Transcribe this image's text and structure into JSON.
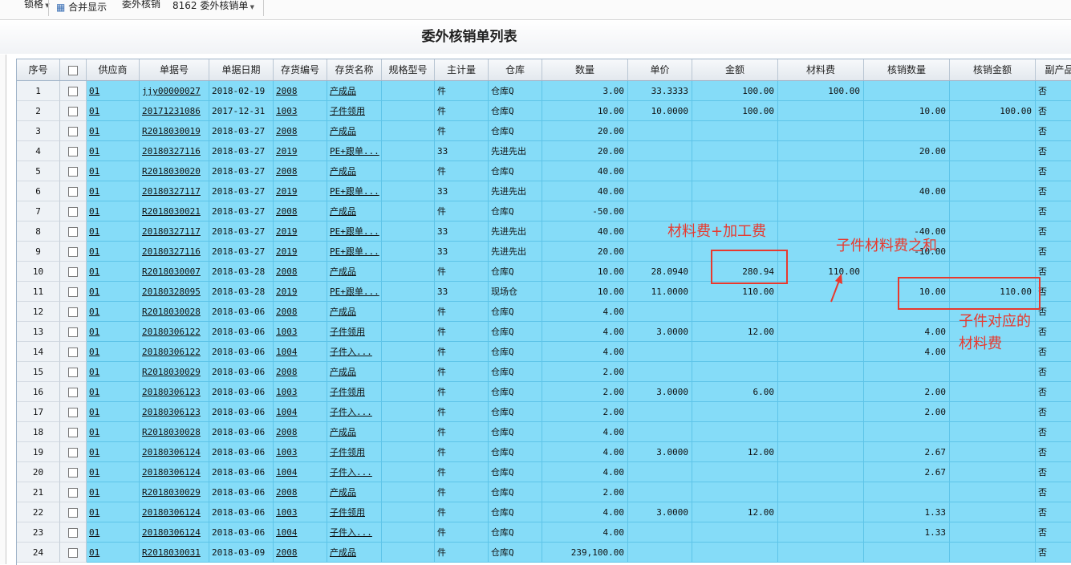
{
  "toolbar": {
    "items": [
      "锁格",
      "合并显示",
      "委外核销",
      "8162 委外核销单"
    ],
    "pos": [
      30,
      70,
      152,
      215
    ]
  },
  "page_title": "委外核销单列表",
  "columns": [
    "序号",
    "",
    "供应商",
    "单据号",
    "单据日期",
    "存货编号",
    "存货名称",
    "规格型号",
    "主计量",
    "仓库",
    "数量",
    "单价",
    "金额",
    "材料费",
    "核销数量",
    "核销金额",
    "副产品"
  ],
  "rows": [
    [
      "1",
      "01",
      "jjy00000027",
      "2018-02-19",
      "2008",
      "产成品",
      "",
      "件",
      "仓库Q",
      "3.00",
      "33.3333",
      "100.00",
      "100.00",
      "",
      "",
      "否"
    ],
    [
      "2",
      "01",
      "20171231086",
      "2017-12-31",
      "1003",
      "子件领用",
      "",
      "件",
      "仓库Q",
      "10.00",
      "10.0000",
      "100.00",
      "",
      "10.00",
      "100.00",
      "否"
    ],
    [
      "3",
      "01",
      "R2018030019",
      "2018-03-27",
      "2008",
      "产成品",
      "",
      "件",
      "仓库Q",
      "20.00",
      "",
      "",
      "",
      "",
      "",
      "否"
    ],
    [
      "4",
      "01",
      "20180327116",
      "2018-03-27",
      "2019",
      "PE+跟单...",
      "",
      "33",
      "先进先出",
      "20.00",
      "",
      "",
      "",
      "20.00",
      "",
      "否"
    ],
    [
      "5",
      "01",
      "R2018030020",
      "2018-03-27",
      "2008",
      "产成品",
      "",
      "件",
      "仓库Q",
      "40.00",
      "",
      "",
      "",
      "",
      "",
      "否"
    ],
    [
      "6",
      "01",
      "20180327117",
      "2018-03-27",
      "2019",
      "PE+跟单...",
      "",
      "33",
      "先进先出",
      "40.00",
      "",
      "",
      "",
      "40.00",
      "",
      "否"
    ],
    [
      "7",
      "01",
      "R2018030021",
      "2018-03-27",
      "2008",
      "产成品",
      "",
      "件",
      "仓库Q",
      "-50.00",
      "",
      "",
      "",
      "",
      "",
      "否"
    ],
    [
      "8",
      "01",
      "20180327117",
      "2018-03-27",
      "2019",
      "PE+跟单...",
      "",
      "33",
      "先进先出",
      "40.00",
      "",
      "",
      "",
      "-40.00",
      "",
      "否"
    ],
    [
      "9",
      "01",
      "20180327116",
      "2018-03-27",
      "2019",
      "PE+跟单...",
      "",
      "33",
      "先进先出",
      "20.00",
      "",
      "",
      "",
      "-10.00",
      "",
      "否"
    ],
    [
      "10",
      "01",
      "R2018030007",
      "2018-03-28",
      "2008",
      "产成品",
      "",
      "件",
      "仓库Q",
      "10.00",
      "28.0940",
      "280.94",
      "110.00",
      "",
      "",
      "否"
    ],
    [
      "11",
      "01",
      "20180328095",
      "2018-03-28",
      "2019",
      "PE+跟单...",
      "",
      "33",
      "现场仓",
      "10.00",
      "11.0000",
      "110.00",
      "",
      "10.00",
      "110.00",
      "否"
    ],
    [
      "12",
      "01",
      "R2018030028",
      "2018-03-06",
      "2008",
      "产成品",
      "",
      "件",
      "仓库Q",
      "4.00",
      "",
      "",
      "",
      "",
      "",
      "否"
    ],
    [
      "13",
      "01",
      "20180306122",
      "2018-03-06",
      "1003",
      "子件领用",
      "",
      "件",
      "仓库Q",
      "4.00",
      "3.0000",
      "12.00",
      "",
      "4.00",
      "",
      "否"
    ],
    [
      "14",
      "01",
      "20180306122",
      "2018-03-06",
      "1004",
      "子件入...",
      "",
      "件",
      "仓库Q",
      "4.00",
      "",
      "",
      "",
      "4.00",
      "",
      "否"
    ],
    [
      "15",
      "01",
      "R2018030029",
      "2018-03-06",
      "2008",
      "产成品",
      "",
      "件",
      "仓库Q",
      "2.00",
      "",
      "",
      "",
      "",
      "",
      "否"
    ],
    [
      "16",
      "01",
      "20180306123",
      "2018-03-06",
      "1003",
      "子件领用",
      "",
      "件",
      "仓库Q",
      "2.00",
      "3.0000",
      "6.00",
      "",
      "2.00",
      "",
      "否"
    ],
    [
      "17",
      "01",
      "20180306123",
      "2018-03-06",
      "1004",
      "子件入...",
      "",
      "件",
      "仓库Q",
      "2.00",
      "",
      "",
      "",
      "2.00",
      "",
      "否"
    ],
    [
      "18",
      "01",
      "R2018030028",
      "2018-03-06",
      "2008",
      "产成品",
      "",
      "件",
      "仓库Q",
      "4.00",
      "",
      "",
      "",
      "",
      "",
      "否"
    ],
    [
      "19",
      "01",
      "20180306124",
      "2018-03-06",
      "1003",
      "子件领用",
      "",
      "件",
      "仓库Q",
      "4.00",
      "3.0000",
      "12.00",
      "",
      "2.67",
      "",
      "否"
    ],
    [
      "20",
      "01",
      "20180306124",
      "2018-03-06",
      "1004",
      "子件入...",
      "",
      "件",
      "仓库Q",
      "4.00",
      "",
      "",
      "",
      "2.67",
      "",
      "否"
    ],
    [
      "21",
      "01",
      "R2018030029",
      "2018-03-06",
      "2008",
      "产成品",
      "",
      "件",
      "仓库Q",
      "2.00",
      "",
      "",
      "",
      "",
      "",
      "否"
    ],
    [
      "22",
      "01",
      "20180306124",
      "2018-03-06",
      "1003",
      "子件领用",
      "",
      "件",
      "仓库Q",
      "4.00",
      "3.0000",
      "12.00",
      "",
      "1.33",
      "",
      "否"
    ],
    [
      "23",
      "01",
      "20180306124",
      "2018-03-06",
      "1004",
      "子件入...",
      "",
      "件",
      "仓库Q",
      "4.00",
      "",
      "",
      "",
      "1.33",
      "",
      "否"
    ],
    [
      "24",
      "01",
      "R2018030031",
      "2018-03-09",
      "2008",
      "产成品",
      "",
      "件",
      "仓库Q",
      "239,100.00",
      "",
      "",
      "",
      "",
      "",
      "否"
    ]
  ],
  "annotations": {
    "a1": "材料费+加工费",
    "a2": "子件材料费之和",
    "a3_line1": "子件对应的",
    "a3_line2": "材料费"
  },
  "colors": {
    "row_bg": "#85dcf8",
    "annotation": "#e8392e"
  }
}
